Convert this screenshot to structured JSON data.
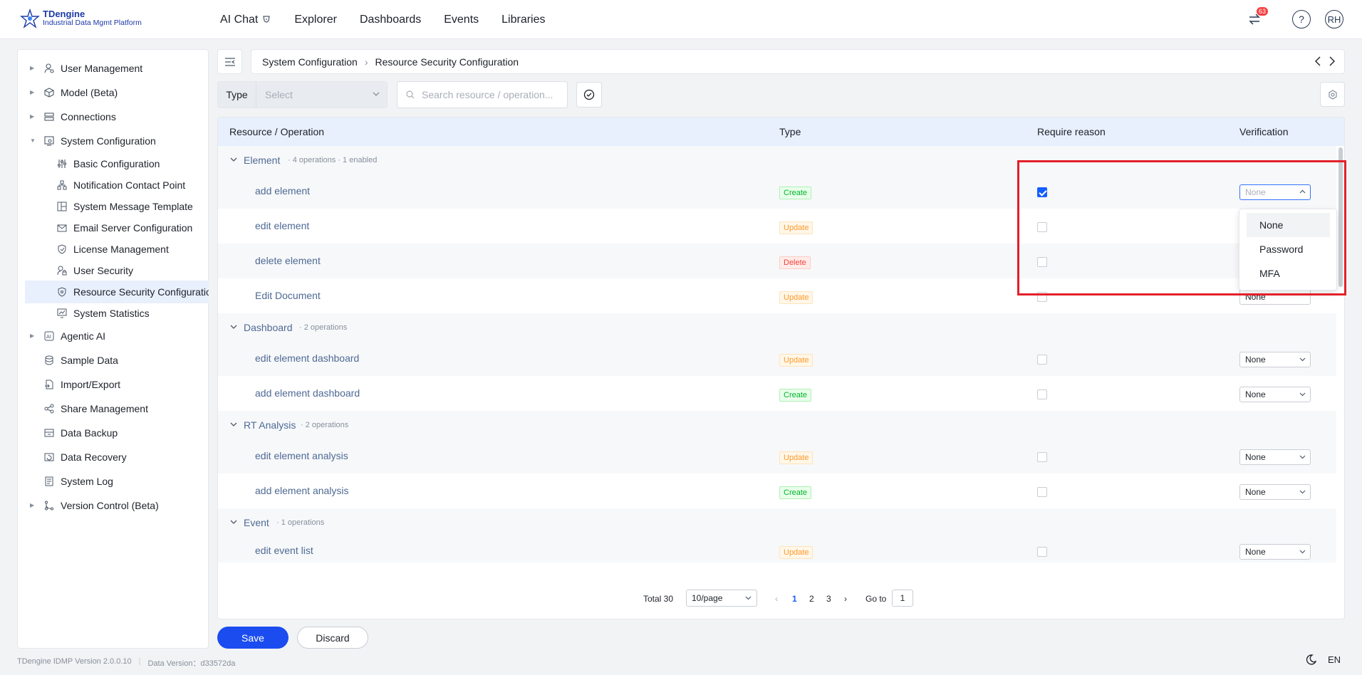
{
  "brand": {
    "name": "TDengine",
    "tagline": "Industrial Data Mgmt Platform"
  },
  "nav": [
    "AI Chat",
    "Explorer",
    "Dashboards",
    "Events",
    "Libraries"
  ],
  "header": {
    "notification_count": "63",
    "help": "?",
    "avatar": "RH"
  },
  "sidebar": {
    "items": [
      {
        "label": "User Management",
        "icon": "user-settings-icon"
      },
      {
        "label": "Model (Beta)",
        "icon": "cube-icon"
      },
      {
        "label": "Connections",
        "icon": "server-icon"
      },
      {
        "label": "System Configuration",
        "icon": "monitor-settings-icon"
      },
      {
        "label": "Basic Configuration",
        "icon": "sliders-icon"
      },
      {
        "label": "Notification Contact Point",
        "icon": "org-chart-icon"
      },
      {
        "label": "System Message Template",
        "icon": "template-icon"
      },
      {
        "label": "Email Server Configuration",
        "icon": "mail-icon"
      },
      {
        "label": "License Management",
        "icon": "shield-check-icon"
      },
      {
        "label": "User Security",
        "icon": "user-lock-icon"
      },
      {
        "label": "Resource Security Configuration",
        "icon": "shield-icon"
      },
      {
        "label": "System Statistics",
        "icon": "stats-icon"
      },
      {
        "label": "Agentic AI",
        "icon": "ai-icon"
      },
      {
        "label": "Sample Data",
        "icon": "database-icon"
      },
      {
        "label": "Import/Export",
        "icon": "import-export-icon"
      },
      {
        "label": "Share Management",
        "icon": "share-icon"
      },
      {
        "label": "Data Backup",
        "icon": "backup-icon"
      },
      {
        "label": "Data Recovery",
        "icon": "recovery-icon"
      },
      {
        "label": "System Log",
        "icon": "log-icon"
      },
      {
        "label": "Version Control (Beta)",
        "icon": "branch-icon"
      }
    ]
  },
  "breadcrumb": [
    "System Configuration",
    "Resource Security Configuration"
  ],
  "filters": {
    "type_label": "Type",
    "type_placeholder": "Select",
    "search_placeholder": "Search resource / operation..."
  },
  "table": {
    "columns": [
      "Resource / Operation",
      "Type",
      "Require reason",
      "Verification"
    ],
    "groups": [
      {
        "name": "Element",
        "meta": "· 4 operations · 1 enabled",
        "rows": [
          {
            "name": "add element",
            "type": "Create",
            "require_reason": true,
            "verification": "None"
          },
          {
            "name": "edit element",
            "type": "Update",
            "require_reason": false,
            "verification": "None"
          },
          {
            "name": "delete element",
            "type": "Delete",
            "require_reason": false,
            "verification": "None"
          },
          {
            "name": "Edit Document",
            "type": "Update",
            "require_reason": false,
            "verification": "None"
          }
        ]
      },
      {
        "name": "Dashboard",
        "meta": "· 2 operations",
        "rows": [
          {
            "name": "edit element dashboard",
            "type": "Update",
            "require_reason": false,
            "verification": "None"
          },
          {
            "name": "add element dashboard",
            "type": "Create",
            "require_reason": false,
            "verification": "None"
          }
        ]
      },
      {
        "name": "RT Analysis",
        "meta": "· 2 operations",
        "rows": [
          {
            "name": "edit element analysis",
            "type": "Update",
            "require_reason": false,
            "verification": "None"
          },
          {
            "name": "add element analysis",
            "type": "Create",
            "require_reason": false,
            "verification": "None"
          }
        ]
      },
      {
        "name": "Event",
        "meta": "· 1 operations",
        "rows": [
          {
            "name": "edit event list",
            "type": "Update",
            "require_reason": false,
            "verification": "None"
          }
        ]
      }
    ]
  },
  "verification_dropdown": {
    "options": [
      "None",
      "Password",
      "MFA"
    ],
    "selected": "None"
  },
  "pagination": {
    "total": "Total 30",
    "page_size": "10/page",
    "pages": [
      "1",
      "2",
      "3"
    ],
    "current": "1",
    "goto_label": "Go to",
    "goto_value": "1"
  },
  "actions": {
    "save": "Save",
    "discard": "Discard"
  },
  "footer": {
    "version": "TDengine IDMP Version 2.0.0.10",
    "data_version": "Data Version：d33572da",
    "lang": "EN"
  },
  "colors": {
    "primary": "#1a4cf0",
    "accent": "#165dff",
    "highlight": "#e3202a"
  }
}
